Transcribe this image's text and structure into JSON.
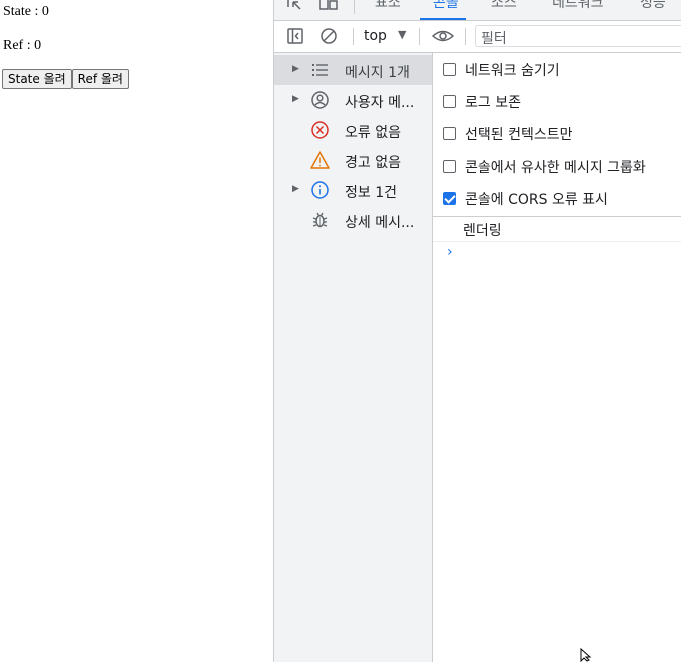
{
  "page": {
    "state_text": "State : 0",
    "ref_text": "Ref : 0",
    "state_button": "State 올려",
    "ref_button": "Ref 올려"
  },
  "devtools": {
    "tabs": [
      "표소",
      "콘솔",
      "소스",
      "네트워크",
      "성능"
    ],
    "toolbar": {
      "context": "top",
      "filter_placeholder": "필터"
    },
    "sidebar": {
      "items": [
        {
          "label": "메시지 1개",
          "icon": "list-icon"
        },
        {
          "label": "사용자 메...",
          "icon": "user-icon"
        },
        {
          "label": "오류 없음",
          "icon": "error-icon"
        },
        {
          "label": "경고 없음",
          "icon": "warning-icon"
        },
        {
          "label": "정보 1건",
          "icon": "info-icon"
        },
        {
          "label": "상세 메시...",
          "icon": "bug-icon"
        }
      ]
    },
    "settings": [
      {
        "label": "네트워크 숨기기",
        "checked": false
      },
      {
        "label": "로그 보존",
        "checked": false
      },
      {
        "label": "선택된 컨텍스트만",
        "checked": false
      },
      {
        "label": "콘솔에서 유사한 메시지 그룹화",
        "checked": false
      },
      {
        "label": "콘솔에 CORS 오류 표시",
        "checked": true
      }
    ],
    "log": {
      "message": "렌더링"
    },
    "prompt": "›"
  },
  "colors": {
    "accent": "#1a73e8",
    "error": "#d93025",
    "warning": "#e37400"
  }
}
